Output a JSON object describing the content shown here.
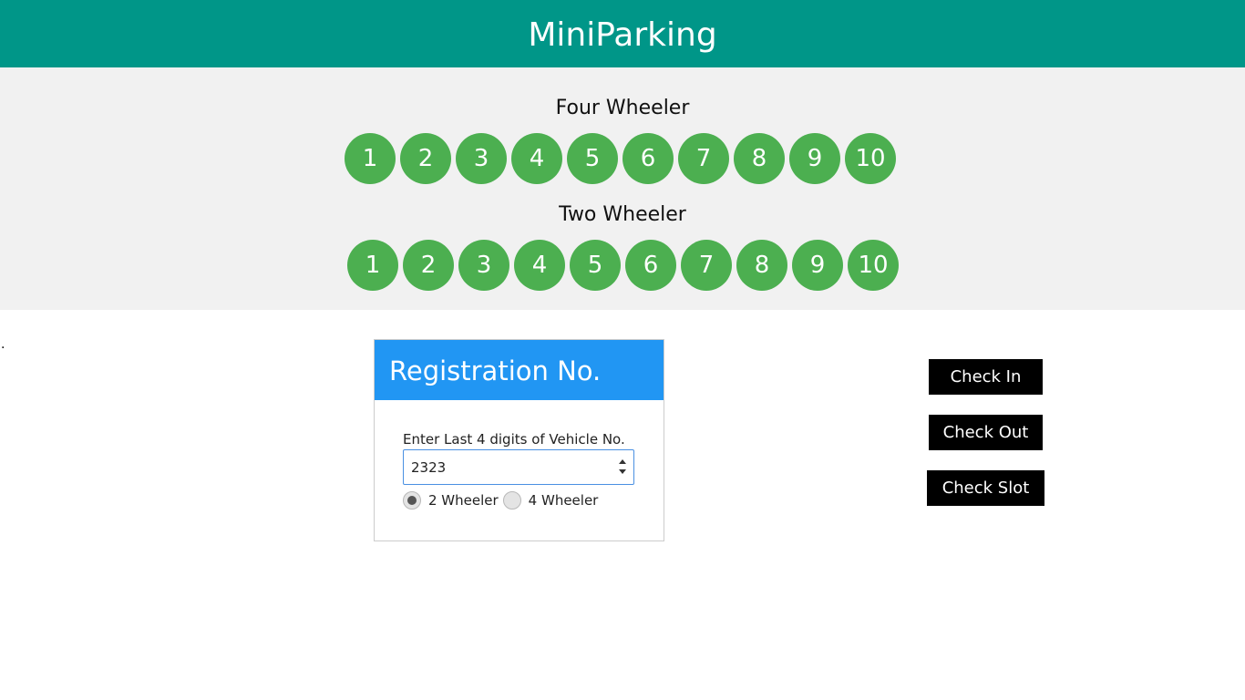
{
  "header": {
    "title": "MiniParking"
  },
  "four_wheeler": {
    "title": "Four Wheeler",
    "slots": [
      "1",
      "2",
      "3",
      "4",
      "5",
      "6",
      "7",
      "8",
      "9",
      "10"
    ],
    "slot_color": "#4caf50"
  },
  "two_wheeler": {
    "title": "Two Wheeler",
    "slots": [
      "1",
      "2",
      "3",
      "4",
      "5",
      "6",
      "7",
      "8",
      "9",
      "10"
    ],
    "slot_color": "#4caf50"
  },
  "stray_text": ".",
  "registration": {
    "title": "Registration No.",
    "label": "Enter Last 4 digits of Vehicle No.",
    "value": "2323",
    "options": [
      {
        "label": "2 Wheeler",
        "checked": true
      },
      {
        "label": "4 Wheeler",
        "checked": false
      }
    ]
  },
  "actions": {
    "check_in": "Check In",
    "check_out": "Check Out",
    "check_slot": "Check Slot"
  },
  "colors": {
    "header": "#009688",
    "panel": "#f1f1f1",
    "card_header": "#2196f3",
    "buttons": "#000000"
  }
}
